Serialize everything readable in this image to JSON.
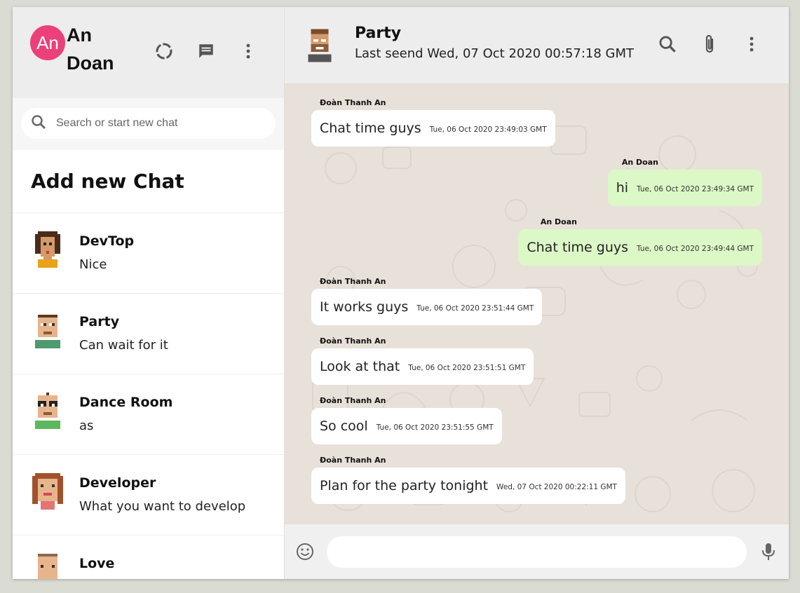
{
  "user": {
    "initials": "An",
    "name": "An Doan"
  },
  "sidebar": {
    "icons": [
      "status-icon",
      "new-chat-icon",
      "menu-icon"
    ],
    "search_placeholder": "Search or start new chat",
    "add_new_chat": "Add new Chat",
    "chats": [
      {
        "name": "DevTop",
        "last": "Nice"
      },
      {
        "name": "Party",
        "last": "Can wait for it"
      },
      {
        "name": "Dance Room",
        "last": "as"
      },
      {
        "name": "Developer",
        "last": "What you want to develop"
      },
      {
        "name": "Love",
        "last": ""
      }
    ]
  },
  "chat": {
    "name": "Party",
    "status": "Last seend Wed, 07 Oct 2020 00:57:18 GMT",
    "icons": [
      "search-icon",
      "attach-icon",
      "menu-icon"
    ],
    "messages": [
      {
        "side": "left",
        "sender": "Đoàn Thanh An",
        "text": "Chat time guys",
        "time": "Tue, 06 Oct 2020 23:49:03 GMT"
      },
      {
        "side": "right",
        "sender": "An Doan",
        "text": "hi",
        "time": "Tue, 06 Oct 2020 23:49:34 GMT"
      },
      {
        "side": "right",
        "sender": "An Doan",
        "text": "Chat time guys",
        "time": "Tue, 06 Oct 2020 23:49:44 GMT"
      },
      {
        "side": "left",
        "sender": "Đoàn Thanh An",
        "text": "It works guys",
        "time": "Tue, 06 Oct 2020 23:51:44 GMT"
      },
      {
        "side": "left",
        "sender": "Đoàn Thanh An",
        "text": "Look at that",
        "time": "Tue, 06 Oct 2020 23:51:51 GMT"
      },
      {
        "side": "left",
        "sender": "Đoàn Thanh An",
        "text": "So cool",
        "time": "Tue, 06 Oct 2020 23:51:55 GMT"
      },
      {
        "side": "left",
        "sender": "Đoàn Thanh An",
        "text": "Plan for the party tonight",
        "time": "Wed, 07 Oct 2020 00:22:11 GMT"
      }
    ],
    "input_placeholder": "",
    "footer_icons": [
      "emoji-icon",
      "microphone-icon"
    ]
  },
  "colors": {
    "accent_avatar": "#ec407a",
    "outgoing_bubble": "#dcf8c6",
    "incoming_bubble": "#ffffff",
    "chat_bg": "#e5ddd5",
    "header_bg": "#ededed"
  }
}
